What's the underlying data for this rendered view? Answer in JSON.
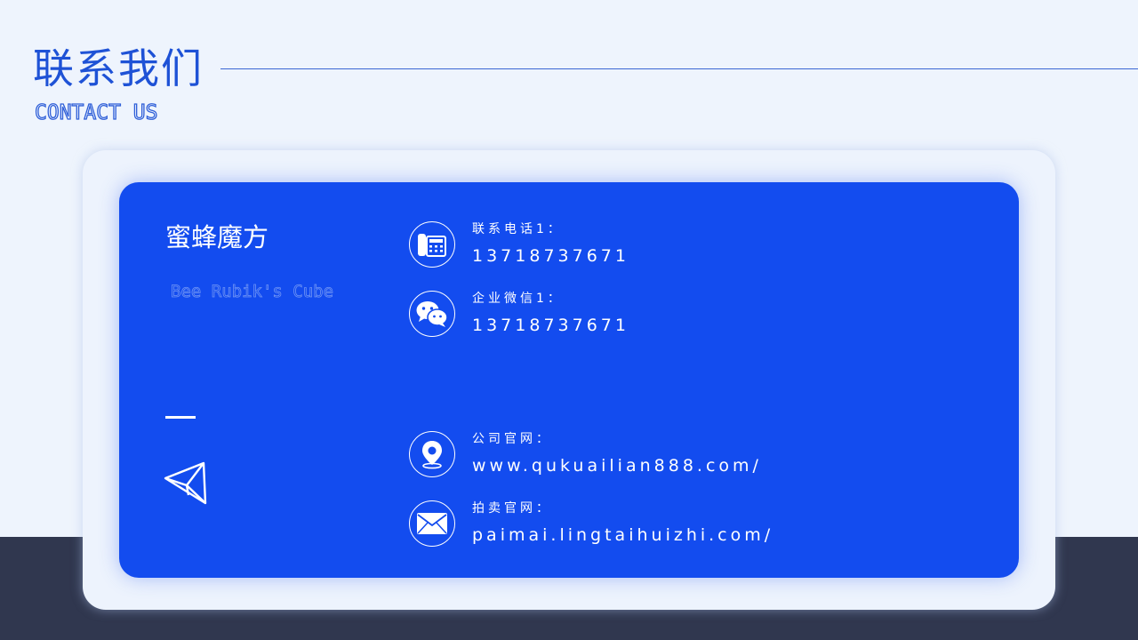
{
  "header": {
    "title_cn": "联系我们",
    "title_en": "CONTACT US"
  },
  "brand": {
    "name_cn": "蜜蜂魔方",
    "name_en": "Bee Rubik's Cube"
  },
  "contacts": [
    {
      "icon": "telephone-icon",
      "label": "联系电话1：",
      "value": "13718737671"
    },
    {
      "icon": "wechat-icon",
      "label": "企业微信1：",
      "value": "13718737671"
    },
    {
      "icon": "location-pin-icon",
      "label": "公司官网：",
      "value": "www.qukuailian888.com/"
    },
    {
      "icon": "envelope-icon",
      "label": "拍卖官网：",
      "value": "paimai.lingtaihuizhi.com/"
    }
  ],
  "colors": {
    "accent_blue": "#134cef",
    "title_blue": "#1e52d6",
    "page_background": "#eef4fd",
    "dark_band": "#30374f"
  }
}
